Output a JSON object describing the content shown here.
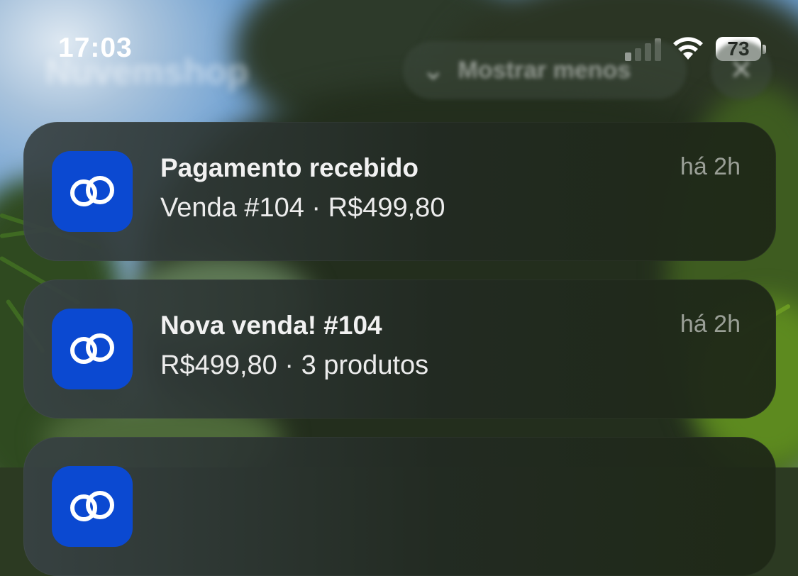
{
  "status_bar": {
    "time": "17:03",
    "battery_level": "73",
    "signal_bars_active": 1,
    "signal_bars_total": 4,
    "wifi_icon": "wifi-icon"
  },
  "group_header": {
    "app_name": "Nuvemshop",
    "show_less_label": "Mostrar menos",
    "chevron_icon": "chevron-down-icon",
    "close_icon": "close-icon"
  },
  "notifications": [
    {
      "app_icon": "nuvemshop-logo-icon",
      "title": "Pagamento recebido",
      "body": "Venda #104 · R$499,80",
      "time": "há 2h"
    },
    {
      "app_icon": "nuvemshop-logo-icon",
      "title": "Nova venda! #104",
      "body": "R$499,80 · 3 produtos",
      "time": "há 2h"
    },
    {
      "app_icon": "nuvemshop-logo-icon",
      "title": "",
      "body": "",
      "time": ""
    }
  ],
  "colors": {
    "app_icon_bg": "#0b49d1",
    "notification_text": "#f1f1f1",
    "timestamp_text": "#9aa19a"
  }
}
